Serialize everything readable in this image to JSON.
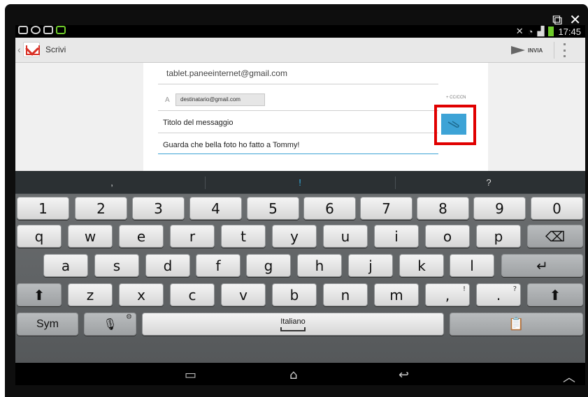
{
  "window": {
    "popout_icon": "⧉",
    "close_icon": "✕"
  },
  "statusbar": {
    "time": "17:45",
    "icons": [
      "voicemail-icon",
      "sync-icon",
      "download-icon",
      "usb-icon",
      "mute-icon",
      "wifi-icon",
      "signal-icon",
      "battery-icon"
    ]
  },
  "actionbar": {
    "title": "Scrivi",
    "send_label": "INVIA"
  },
  "compose": {
    "from": "tablet.paneeinternet@gmail.com",
    "to_label": "A",
    "recipient": "destinatario@gmail.com",
    "cc_link": "+ CC/CCN",
    "subject": "Titolo del messaggio",
    "body": "Guarda che bella foto ho fatto a Tommy!"
  },
  "suggestions": [
    ",",
    "!",
    "?"
  ],
  "keyboard": {
    "row_numbers": [
      "1",
      "2",
      "3",
      "4",
      "5",
      "6",
      "7",
      "8",
      "9",
      "0"
    ],
    "row_top": [
      "q",
      "w",
      "e",
      "r",
      "t",
      "y",
      "u",
      "i",
      "o",
      "p"
    ],
    "row_home": [
      "a",
      "s",
      "d",
      "f",
      "g",
      "h",
      "j",
      "k",
      "l"
    ],
    "row_bottom": [
      "z",
      "x",
      "c",
      "v",
      "b",
      "n",
      "m"
    ],
    "comma_key": ",",
    "comma_sub": "!",
    "period_key": ".",
    "period_sub": "?",
    "sym_label": "Sym",
    "space_label": "Italiano",
    "backspace_icon": "⌫",
    "enter_icon": "↵",
    "shift_icon": "⬆",
    "mic_icon": "🎙",
    "clipboard_icon": "📋"
  },
  "navbar": {
    "recent_icon": "▭",
    "home_icon": "⌂",
    "back_icon": "↩",
    "up_icon": "︿"
  }
}
